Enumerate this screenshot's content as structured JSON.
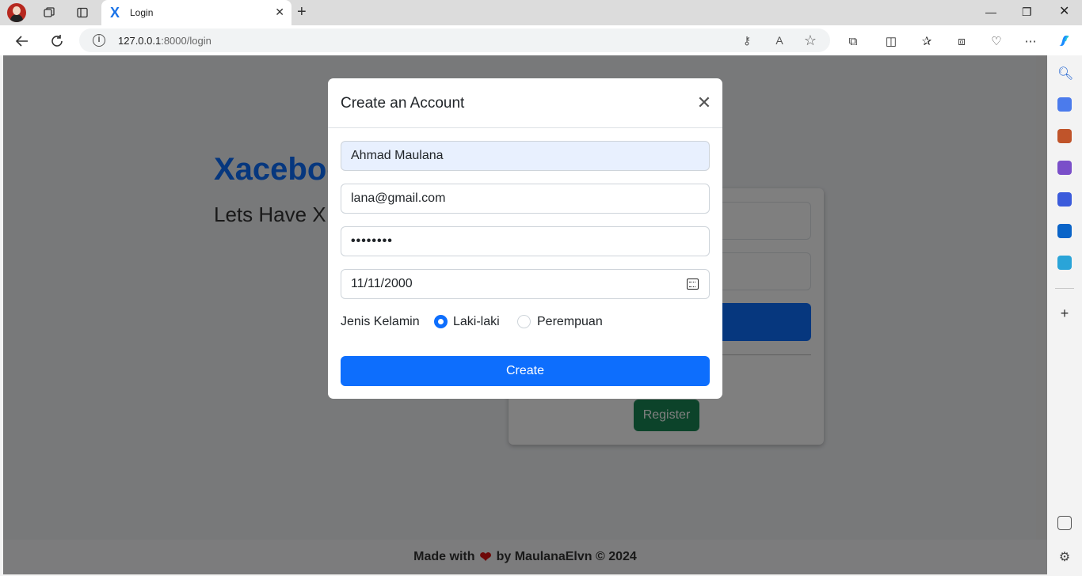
{
  "browser": {
    "tab": {
      "title": "Login",
      "favicon": "X"
    },
    "url": {
      "host": "127.0.0.1",
      "rest": ":8000/login"
    }
  },
  "page": {
    "brand": "Xacebook",
    "tagline": "Lets Have X",
    "register_label": "Register",
    "footer": {
      "prefix": "Made with",
      "suffix": "by MaulanaElvn © 2024"
    }
  },
  "modal": {
    "title": "Create an Account",
    "fields": {
      "name": "Ahmad Maulana",
      "email": "lana@gmail.com",
      "password": "••••••••",
      "birthdate": "11/11/2000"
    },
    "gender": {
      "label": "Jenis Kelamin",
      "options": [
        "Laki-laki",
        "Perempuan"
      ],
      "selected": "Laki-laki"
    },
    "submit_label": "Create"
  },
  "colors": {
    "primary": "#0d6efd",
    "success": "#198754",
    "autofill": "#e8f0fe"
  }
}
